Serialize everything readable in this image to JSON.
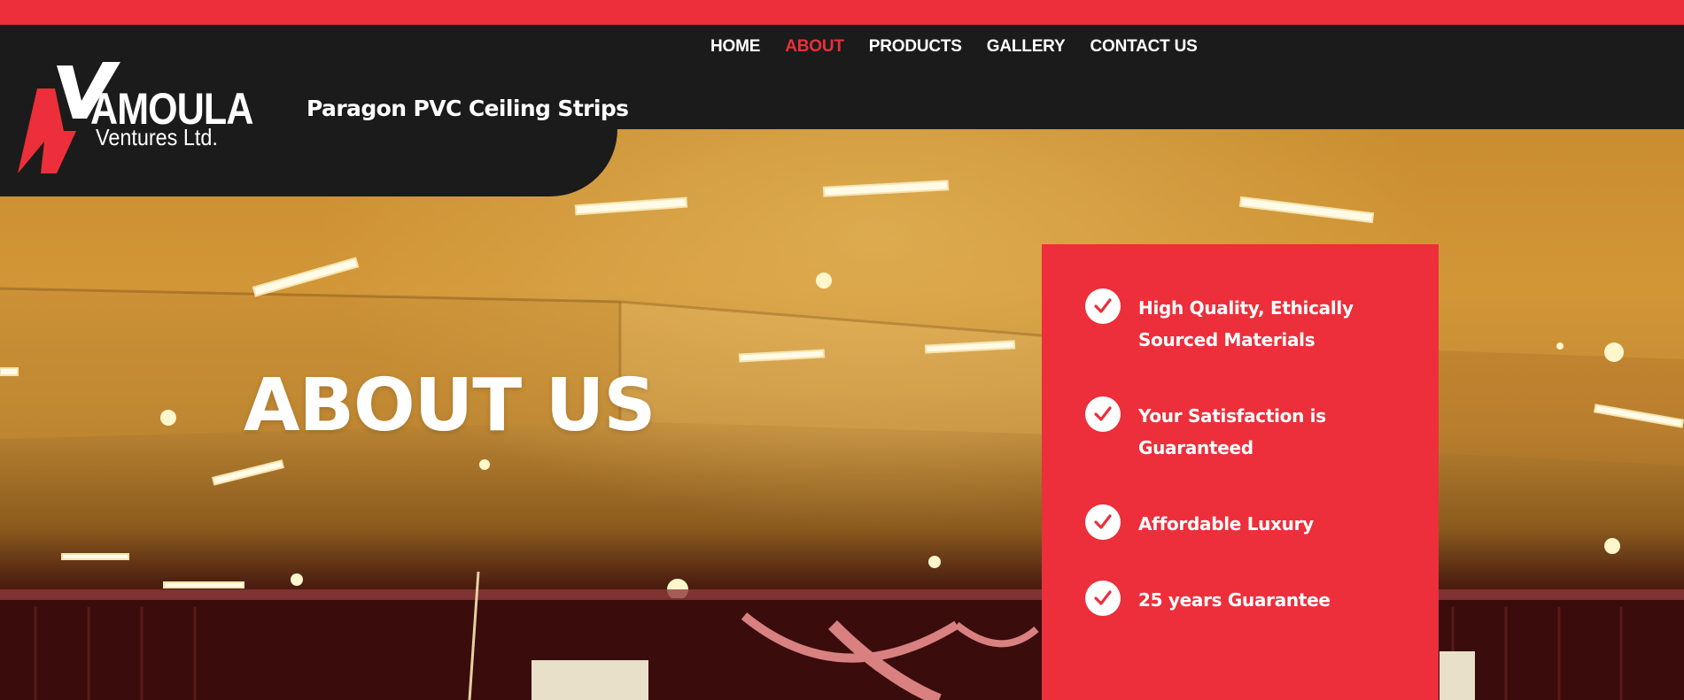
{
  "colors": {
    "accent": "#ec2f3a",
    "header_bg": "#1b1b1b",
    "text_light": "#ffffff"
  },
  "nav": {
    "items": [
      {
        "label": "HOME",
        "active": false
      },
      {
        "label": "ABOUT",
        "active": true
      },
      {
        "label": "PRODUCTS",
        "active": false
      },
      {
        "label": "GALLERY",
        "active": false
      },
      {
        "label": "CONTACT US",
        "active": false
      }
    ]
  },
  "brand": {
    "logo_main": "AMOULA",
    "logo_sub": "Ventures Ltd.",
    "tagline": "Paragon PVC Ceiling Strips"
  },
  "hero": {
    "title": "ABOUT US",
    "image": "ceiling-hall-photo"
  },
  "features": {
    "icon": "check-circle-icon",
    "items": [
      {
        "text": "High Quality, Ethically Sourced Materials"
      },
      {
        "text": "Your Satisfaction is Guaranteed"
      },
      {
        "text": "Affordable Luxury"
      },
      {
        "text": "25 years Guarantee"
      }
    ]
  }
}
